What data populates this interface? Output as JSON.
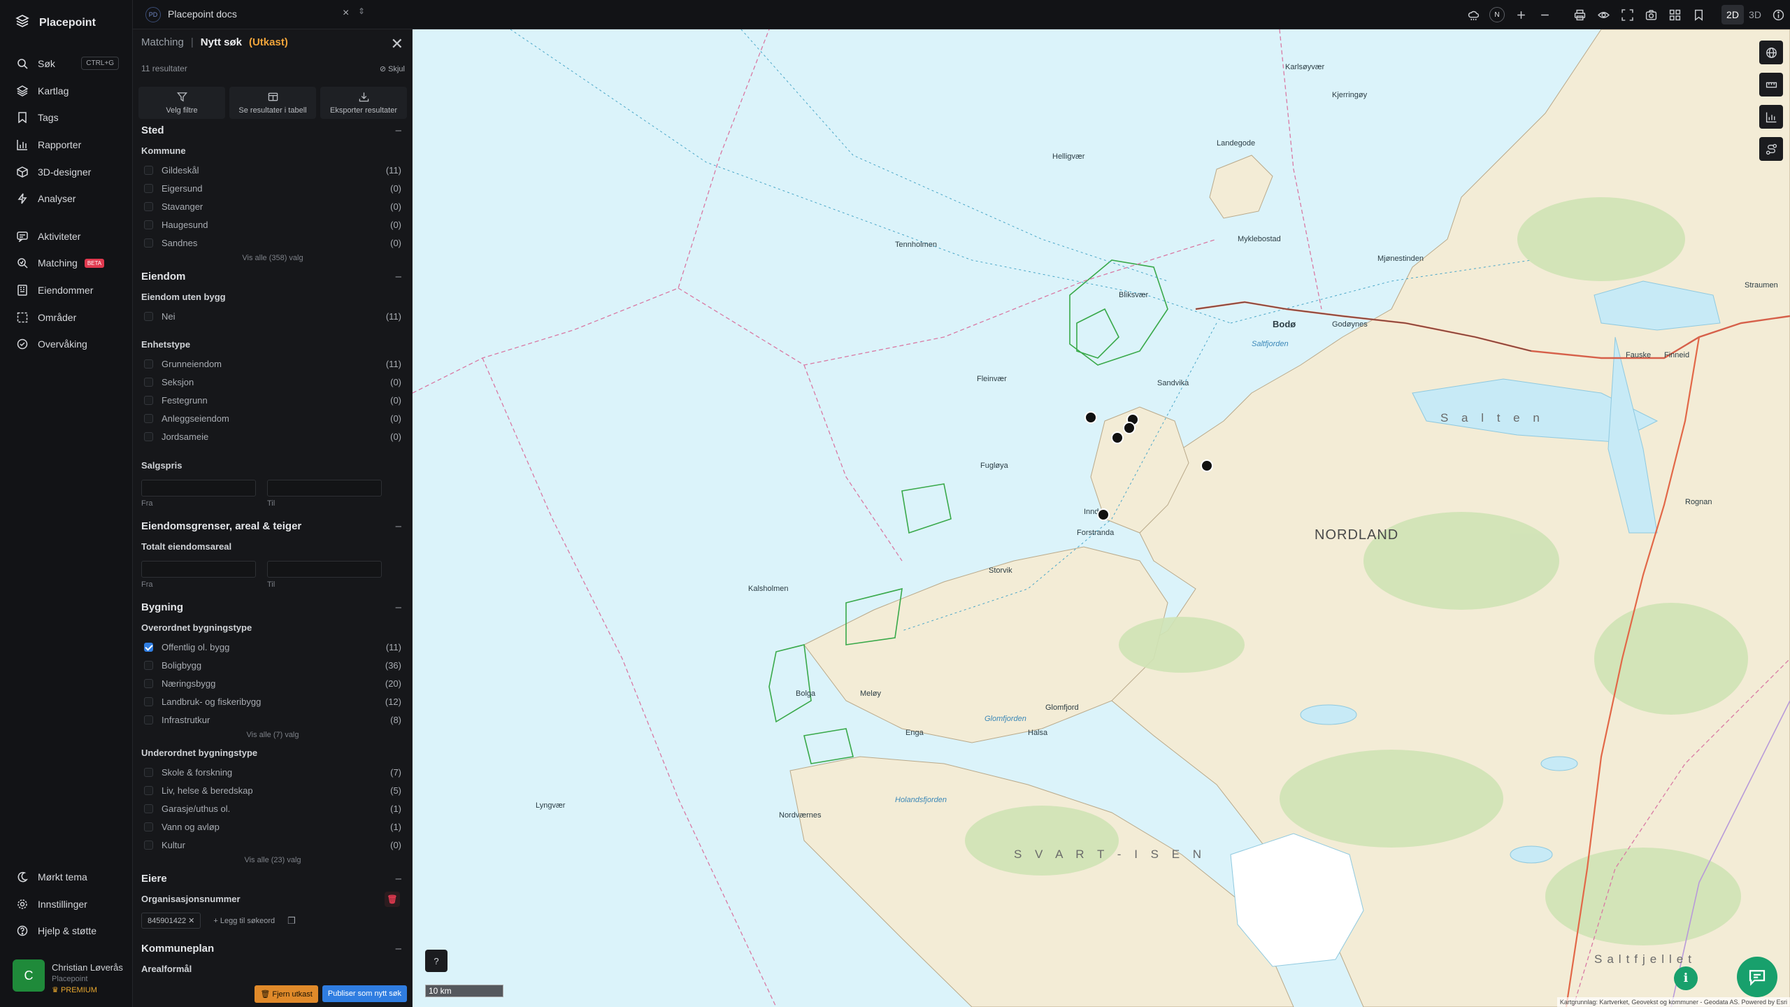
{
  "app": {
    "name": "Placepoint"
  },
  "nav": {
    "items": [
      {
        "label": "Søk",
        "shortcut": "CTRL+G"
      },
      {
        "label": "Kartlag"
      },
      {
        "label": "Tags"
      },
      {
        "label": "Rapporter"
      },
      {
        "label": "3D-designer"
      },
      {
        "label": "Analyser"
      },
      {
        "label": "Aktiviteter"
      },
      {
        "label": "Matching",
        "badge": "BETA"
      },
      {
        "label": "Eiendommer"
      },
      {
        "label": "Områder"
      },
      {
        "label": "Overvåking"
      }
    ],
    "bottom": [
      {
        "label": "Mørkt tema"
      },
      {
        "label": "Innstillinger"
      },
      {
        "label": "Hjelp & støtte"
      }
    ],
    "user": {
      "initial": "C",
      "name": "Christian Løverås",
      "org": "Placepoint",
      "plan": "PREMIUM"
    }
  },
  "topbar": {
    "doc_badge": "PD",
    "doc_title": "Placepoint docs",
    "compass": "N",
    "mode_2d": "2D",
    "mode_3d": "3D"
  },
  "panel": {
    "breadcrumb": "Matching",
    "title": "Nytt søk",
    "status": "(Utkast)",
    "result_count": "11 resultater",
    "hide_label": "Skjul",
    "actions": [
      "Velg filtre",
      "Se resultater i tabell",
      "Eksporter resultater"
    ],
    "sted": {
      "title": "Sted",
      "kommune_label": "Kommune",
      "kommune": [
        {
          "label": "Gildeskål",
          "count": "(11)"
        },
        {
          "label": "Eigersund",
          "count": "(0)"
        },
        {
          "label": "Stavanger",
          "count": "(0)"
        },
        {
          "label": "Haugesund",
          "count": "(0)"
        },
        {
          "label": "Sandnes",
          "count": "(0)"
        }
      ],
      "more": "Vis alle (358) valg"
    },
    "eiendom": {
      "title": "Eiendom",
      "uten_bygg_label": "Eiendom uten bygg",
      "uten_bygg": [
        {
          "label": "Nei",
          "count": "(11)"
        }
      ],
      "enhetstype_label": "Enhetstype",
      "enhetstype": [
        {
          "label": "Grunneiendom",
          "count": "(11)"
        },
        {
          "label": "Seksjon",
          "count": "(0)"
        },
        {
          "label": "Festegrunn",
          "count": "(0)"
        },
        {
          "label": "Anleggseiendom",
          "count": "(0)"
        },
        {
          "label": "Jordsameie",
          "count": "(0)"
        }
      ],
      "salgspris_label": "Salgspris",
      "from": "Fra",
      "to": "Til"
    },
    "grenser": {
      "title": "Eiendomsgrenser, areal & teiger",
      "areal_label": "Totalt eiendomsareal",
      "from": "Fra",
      "to": "Til"
    },
    "bygning": {
      "title": "Bygning",
      "over_label": "Overordnet bygningstype",
      "over": [
        {
          "label": "Offentlig ol. bygg",
          "count": "(11)",
          "checked": true
        },
        {
          "label": "Boligbygg",
          "count": "(36)"
        },
        {
          "label": "Næringsbygg",
          "count": "(20)"
        },
        {
          "label": "Landbruk- og fiskeribygg",
          "count": "(12)"
        },
        {
          "label": "Infrastrutkur",
          "count": "(8)"
        }
      ],
      "over_more": "Vis alle (7) valg",
      "under_label": "Underordnet bygningstype",
      "under": [
        {
          "label": "Skole & forskning",
          "count": "(7)"
        },
        {
          "label": "Liv, helse & beredskap",
          "count": "(5)"
        },
        {
          "label": "Garasje/uthus ol.",
          "count": "(1)"
        },
        {
          "label": "Vann og avløp",
          "count": "(1)"
        },
        {
          "label": "Kultur",
          "count": "(0)"
        }
      ],
      "under_more": "Vis alle (23) valg"
    },
    "eiere": {
      "title": "Eiere",
      "org_label": "Organisasjonsnummer",
      "org_chip": "845901422",
      "add_label": "Legg til søkeord"
    },
    "kommuneplan": {
      "title": "Kommuneplan",
      "arealformal": "Arealformål"
    },
    "footer": {
      "remove": "Fjern utkast",
      "publish": "Publiser som nytt søk"
    }
  },
  "map": {
    "scale": "10 km",
    "region": "NORDLAND",
    "attribution": "Kartgrunnlag: Kartverket, Geovekst og kommuner - Geodata AS. Powered by Esri",
    "labels": {
      "tennholmen": "Tennholmen",
      "helligvaer": "Helligvær",
      "landegode": "Landegode",
      "bliksvaer": "Bliksvær",
      "bodo": "Bodø",
      "godoynes": "Godøynes",
      "saltfjorden": "Saltfjorden",
      "salten": "S a l t e n",
      "fauske": "Fauske",
      "finneid": "Finneid",
      "kalsholmen": "Kalsholmen",
      "fleinvaer": "Fleinvær",
      "sandvika": "Sandvika",
      "fugloya": "Fugløya",
      "inndyr": "Inndyr",
      "forstranda": "Forstranda",
      "mjonestinden": "Mjønestinden",
      "straumen": "Straumen",
      "storvik": "Storvik",
      "bolga": "Bolga",
      "meloy": "Meløy",
      "enga": "Enga",
      "glomfjord": "Glomfjord",
      "holandsfjorden": "Holandsfjorden",
      "svartisen": "S V A R T - I S E N",
      "lyngvaer": "Lyngvær",
      "saltfjellet": "Saltfjellet",
      "rognan": "Rognan",
      "karlsoyvaer": "Karlsøyvær",
      "nordvaernes": "Nordværnes",
      "kjerringoy": "Kjerringøy",
      "myklebostad": "Myklebostad",
      "glomfjorden": "Glomfjorden",
      "halsa": "Halsa"
    },
    "markers": [
      {
        "lat": 67.0,
        "count": "1"
      },
      {
        "lat": 67.0,
        "count": "1"
      },
      {
        "lat": 67.0,
        "count": "1"
      },
      {
        "lat": 67.0,
        "count": "1"
      },
      {
        "lat": 67.0,
        "count": "1"
      },
      {
        "lat": 67.0,
        "count": "1"
      }
    ]
  },
  "colors": {
    "accent": "#2f7de1",
    "draft": "#f0a43a",
    "danger": "#e0394f",
    "sea": "#dbf3fa",
    "chat": "#18a06c"
  }
}
